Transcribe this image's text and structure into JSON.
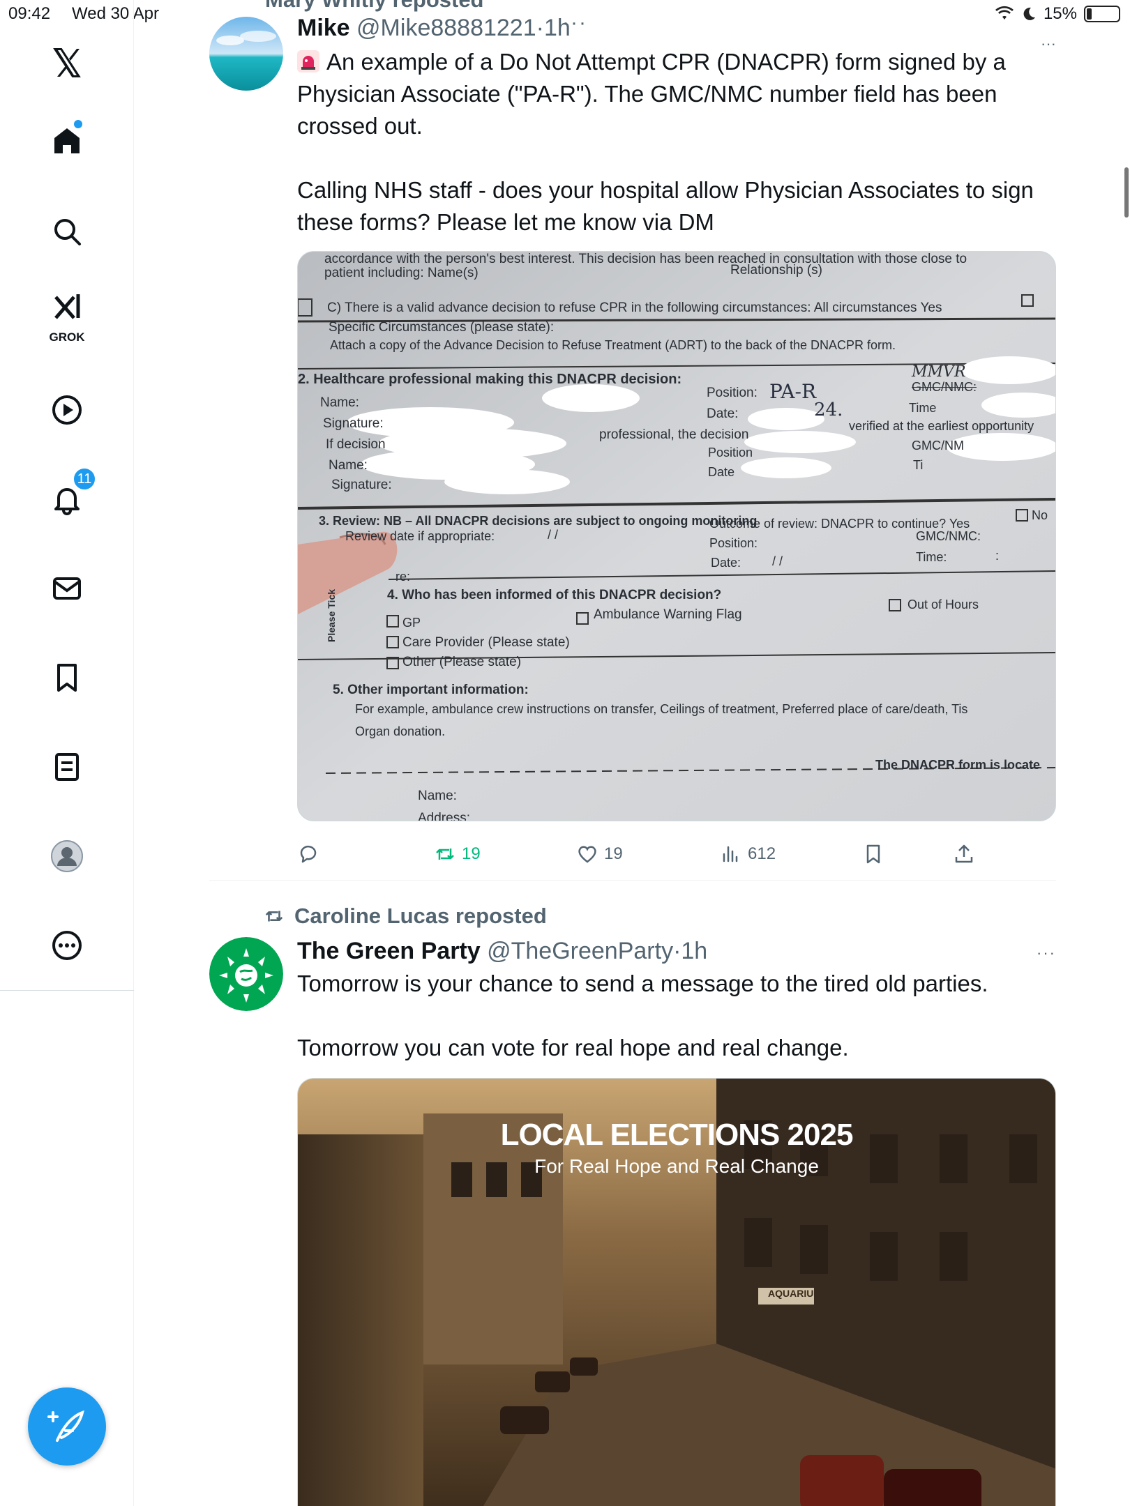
{
  "status_bar": {
    "time": "09:42",
    "date": "Wed 30 Apr",
    "battery": "15%",
    "battery_level": 0.15
  },
  "sidebar": {
    "grok_label": "GROK",
    "notifications_badge": "11"
  },
  "top_partial": {
    "text": "Mary Whitly reposted"
  },
  "tweet1": {
    "name": "Mike",
    "handle": "@Mike88881221",
    "separator": "·",
    "time": "1h",
    "more": "···",
    "paragraph1": "An example of a Do Not Attempt CPR (DNACPR) form signed by a Physician Associate (\"PA-R\"). The GMC/NMC number field has been crossed out.",
    "paragraph2": "Calling NHS staff - does your hospital allow Physician Associates to sign these forms? Please let me know via DM",
    "form": {
      "line1": "accordance with the person's best interest. This decision has been reached in consultation with those close to",
      "line2": "patient including: Name(s)",
      "line2b": "Relationship (s)",
      "line3": "C) There is a valid advance decision to refuse CPR in the following circumstances: All circumstances Yes",
      "line4": "Specific Circumstances (please state):",
      "line5": "Attach a copy of the Advance Decision to Refuse Treatment (ADRT) to the back of the DNACPR form.",
      "section2": "2. Healthcare professional making this DNACPR decision:",
      "name": "Name:",
      "signature": "Signature:",
      "if_decision": "If decision",
      "name2": "Name:",
      "signature2": "Signature:",
      "position": "Position:",
      "position_value": "PA-R",
      "date": "Date:",
      "date_value": "24.",
      "professional": "professional, the decision",
      "verified": "verified at the earliest opportunity",
      "gmc_nmc": "GMC/NMC:",
      "mmvr": "MMVR",
      "time": "Time",
      "gmc_nm": "GMC/NM",
      "ti": "Ti",
      "position2": "Position",
      "date2": "Date",
      "section3": "3. Review: NB – All DNACPR decisions are subject to ongoing monitoring",
      "review_date": "Review date if appropriate:",
      "review_slashes": "/      /",
      "outcome": "Outcome of review: DNACPR to continue?  Yes",
      "no": "No",
      "position3": "Position:",
      "gmc3": "GMC/NMC:",
      "date3": "Date:",
      "date3_slashes": "/      /",
      "time3": "Time:",
      "time3_colon": ":",
      "re": "re:",
      "section4": "4. Who has been informed of this DNACPR decision?",
      "gp": "GP",
      "ambulance": "Ambulance Warning Flag",
      "out_of_hours": "Out of Hours",
      "care_provider": "Care Provider (Please state)",
      "other": "Other (Please state)",
      "please_tick": "Please Tick",
      "section5": "5. Other important information:",
      "example": "For example, ambulance crew instructions on transfer, Ceilings of treatment, Preferred place of care/death, Tis",
      "organ": "Organ donation.",
      "located": "The DNACPR form is locate",
      "name5": "Name:",
      "address": "Address:"
    },
    "actions": {
      "reply": "",
      "retweets": "19",
      "likes": "19",
      "views": "612"
    }
  },
  "tweet2": {
    "reposted_by": "Caroline Lucas reposted",
    "name": "The Green Party",
    "handle": "@TheGreenParty",
    "separator": "·",
    "time": "1h",
    "more": "···",
    "paragraph1": "Tomorrow is your chance to send a message to the tired old parties.",
    "paragraph2": "Tomorrow you can vote for real hope and real change.",
    "image_title": "LOCAL ELECTIONS 2025",
    "image_subtitle": "For Real Hope and Real Change",
    "shop_sign": "AQUARIU"
  },
  "colors": {
    "accent": "#1d9bf0",
    "retweet": "#00ba7c",
    "secondary_text": "#536471",
    "green_party": "#00a651"
  }
}
